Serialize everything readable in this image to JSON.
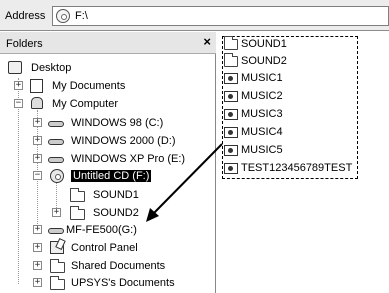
{
  "address_bar": {
    "label": "Address",
    "value": "F:\\"
  },
  "folders_pane": {
    "title": "Folders",
    "close_glyph": "×",
    "tree": [
      {
        "label": "Desktop",
        "icon": "desktop-icon",
        "expander": ""
      },
      {
        "label": "My Documents",
        "icon": "my-documents-icon",
        "expander": "+"
      },
      {
        "label": "My Computer",
        "icon": "my-computer-icon",
        "expander": "−"
      },
      {
        "label": "WINDOWS 98 (C:)",
        "icon": "hard-drive-icon",
        "expander": "+"
      },
      {
        "label": "WINDOWS 2000 (D:)",
        "icon": "hard-drive-icon",
        "expander": "+"
      },
      {
        "label": "WINDOWS XP Pro (E:)",
        "icon": "hard-drive-icon",
        "expander": "+"
      },
      {
        "label": "Untitled CD (F:)",
        "icon": "cd-drive-icon",
        "expander": "−",
        "selected": true
      },
      {
        "label": "SOUND1",
        "icon": "folder-icon",
        "expander": ""
      },
      {
        "label": "SOUND2",
        "icon": "folder-icon",
        "expander": "+"
      },
      {
        "label": "MF-FE500(G:)",
        "icon": "removable-drive-icon",
        "expander": "+"
      },
      {
        "label": "Control Panel",
        "icon": "control-panel-icon",
        "expander": "+"
      },
      {
        "label": "Shared Documents",
        "icon": "folder-icon",
        "expander": "+"
      },
      {
        "label": "UPSYS's Documents",
        "icon": "folder-icon",
        "expander": "+"
      }
    ]
  },
  "files": [
    {
      "name": "SOUND1",
      "icon": "folder-icon"
    },
    {
      "name": "SOUND2",
      "icon": "folder-icon"
    },
    {
      "name": "MUSIC1",
      "icon": "audio-file-icon"
    },
    {
      "name": "MUSIC2",
      "icon": "audio-file-icon"
    },
    {
      "name": "MUSIC3",
      "icon": "audio-file-icon"
    },
    {
      "name": "MUSIC4",
      "icon": "audio-file-icon"
    },
    {
      "name": "MUSIC5",
      "icon": "audio-file-icon"
    },
    {
      "name": "TEST123456789TEST",
      "icon": "audio-file-icon"
    }
  ]
}
